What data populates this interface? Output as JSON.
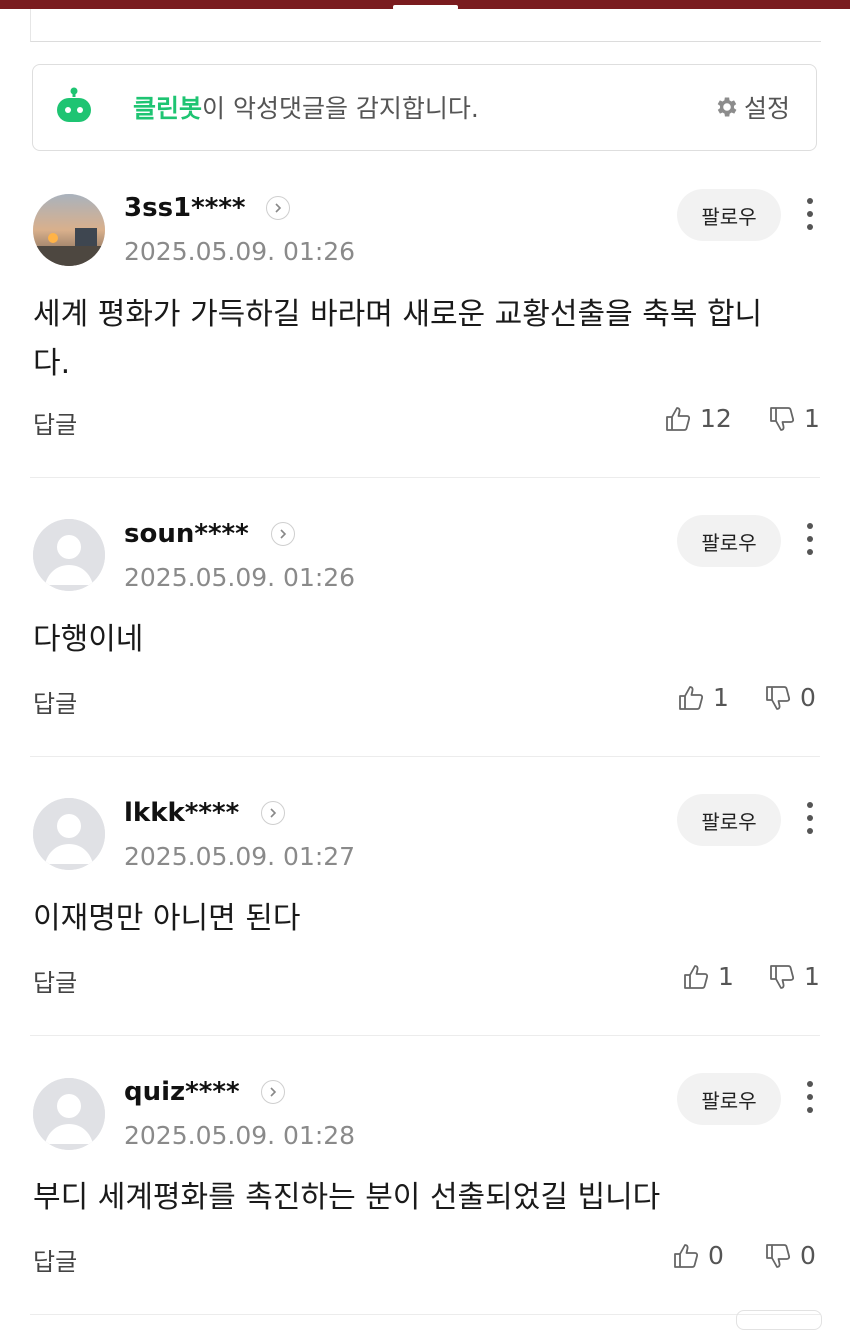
{
  "cleanbot": {
    "name": "클린봇",
    "message": "이 악성댓글을 감지합니다.",
    "settings_label": "설정"
  },
  "comments": [
    {
      "username": "3ss1****",
      "date": "2025.05.09. 01:26",
      "follow_label": "팔로우",
      "text": "세계 평화가 가득하길 바라며 새로운 교황선출을 축복 합니다.",
      "reply_label": "답글",
      "likes": "12",
      "dislikes": "1",
      "avatar": "photo"
    },
    {
      "username": "soun****",
      "date": "2025.05.09. 01:26",
      "follow_label": "팔로우",
      "text": "다행이네",
      "reply_label": "답글",
      "likes": "1",
      "dislikes": "0",
      "avatar": "default"
    },
    {
      "username": "lkkk****",
      "date": "2025.05.09. 01:27",
      "follow_label": "팔로우",
      "text": "이재명만 아니면 된다",
      "reply_label": "답글",
      "likes": "1",
      "dislikes": "1",
      "avatar": "default"
    },
    {
      "username": "quiz****",
      "date": "2025.05.09. 01:28",
      "follow_label": "팔로우",
      "text": "부디 세계평화를 촉진하는 분이 선출되었길 빕니다",
      "reply_label": "답글",
      "likes": "0",
      "dislikes": "0",
      "avatar": "default"
    }
  ],
  "colors": {
    "top_bar": "#7a1c1f",
    "cleanbot_accent": "#1ec472"
  }
}
